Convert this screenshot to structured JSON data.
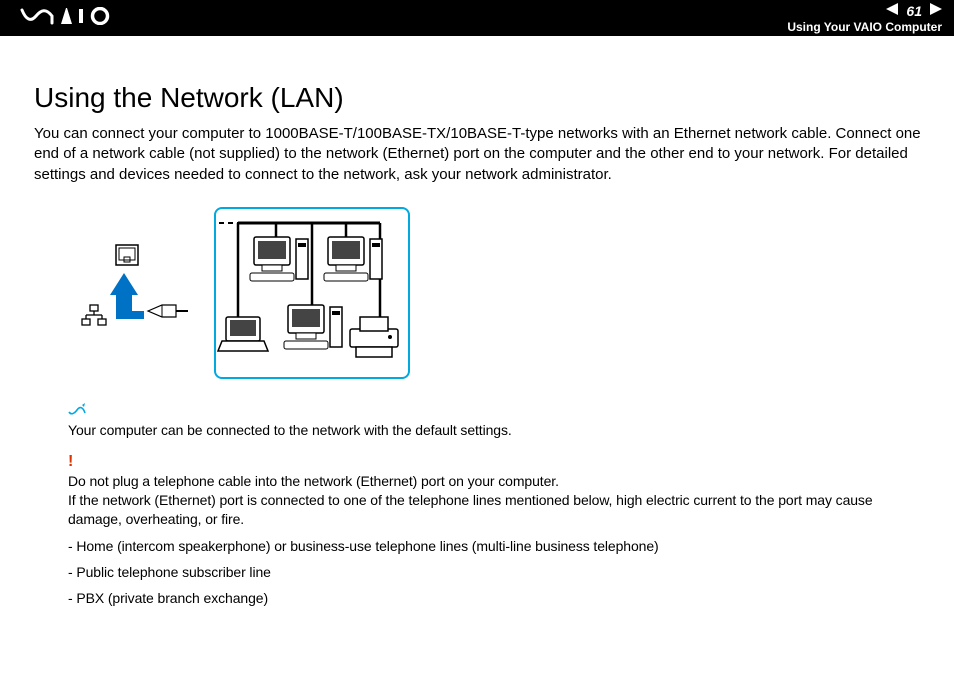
{
  "header": {
    "page_number": "61",
    "section": "Using Your VAIO Computer"
  },
  "main": {
    "title": "Using the Network (LAN)",
    "intro": "You can connect your computer to 1000BASE-T/100BASE-TX/10BASE-T-type networks with an Ethernet network cable. Connect one end of a network cable (not supplied) to the network (Ethernet) port on the computer and the other end to your network. For detailed settings and devices needed to connect to the network, ask your network administrator."
  },
  "note": {
    "text": "Your computer can be connected to the network with the default settings."
  },
  "warning": {
    "line1": "Do not plug a telephone cable into the network (Ethernet) port on your computer.",
    "line2": "If the network (Ethernet) port is connected to one of the telephone lines mentioned below, high electric current to the port may cause damage, overheating, or fire.",
    "bullets": [
      "- Home (intercom speakerphone) or business-use telephone lines (multi-line business telephone)",
      "- Public telephone subscriber line",
      "- PBX (private branch exchange)"
    ]
  }
}
